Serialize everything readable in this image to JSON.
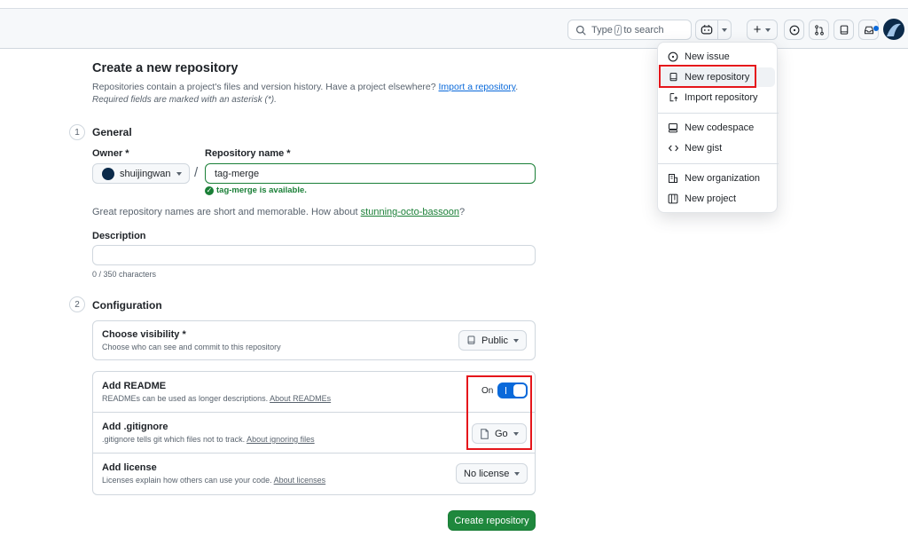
{
  "header": {
    "search_prefix": "Type",
    "search_kbd": "/",
    "search_suffix": "to search"
  },
  "page": {
    "title": "Create a new repository",
    "subtitle_text": "Repositories contain a project's files and version history. Have a project elsewhere?",
    "import_link": "Import a repository",
    "subtitle_end": ".",
    "required_note": "Required fields are marked with an asterisk (*)."
  },
  "general": {
    "step": "1",
    "title": "General",
    "owner_label": "Owner *",
    "owner_value": "shuijingwan",
    "repo_label": "Repository name *",
    "repo_value": "tag-merge",
    "available": "tag-merge is available.",
    "suggest_text": "Great repository names are short and memorable. How about",
    "suggest_link": "stunning-octo-bassoon",
    "suggest_end": "?",
    "desc_label": "Description",
    "char_count": "0 / 350 characters"
  },
  "configuration": {
    "step": "2",
    "title": "Configuration",
    "visibility_title": "Choose visibility *",
    "visibility_desc": "Choose who can see and commit to this repository",
    "visibility_value": "Public",
    "readme_title": "Add README",
    "readme_desc": "READMEs can be used as longer descriptions.",
    "readme_link": "About READMEs",
    "readme_toggle_label": "On",
    "gitignore_title": "Add .gitignore",
    "gitignore_desc": ".gitignore tells git which files not to track.",
    "gitignore_link": "About ignoring files",
    "gitignore_value": "Go",
    "license_title": "Add license",
    "license_desc": "Licenses explain how others can use your code.",
    "license_link": "About licenses",
    "license_value": "No license"
  },
  "create_button": "Create repository",
  "dropdown": {
    "items": [
      {
        "label": "New issue",
        "icon": "issue-icon"
      },
      {
        "label": "New repository",
        "icon": "repo-icon"
      },
      {
        "label": "Import repository",
        "icon": "repo-push-icon"
      },
      {
        "label": "New codespace",
        "icon": "codespace-icon"
      },
      {
        "label": "New gist",
        "icon": "code-icon"
      },
      {
        "label": "New organization",
        "icon": "organization-icon"
      },
      {
        "label": "New project",
        "icon": "project-icon"
      }
    ]
  },
  "colors": {
    "primary_green": "#1f883d",
    "accent_blue": "#0969da",
    "highlight_red": "#e5161b"
  }
}
